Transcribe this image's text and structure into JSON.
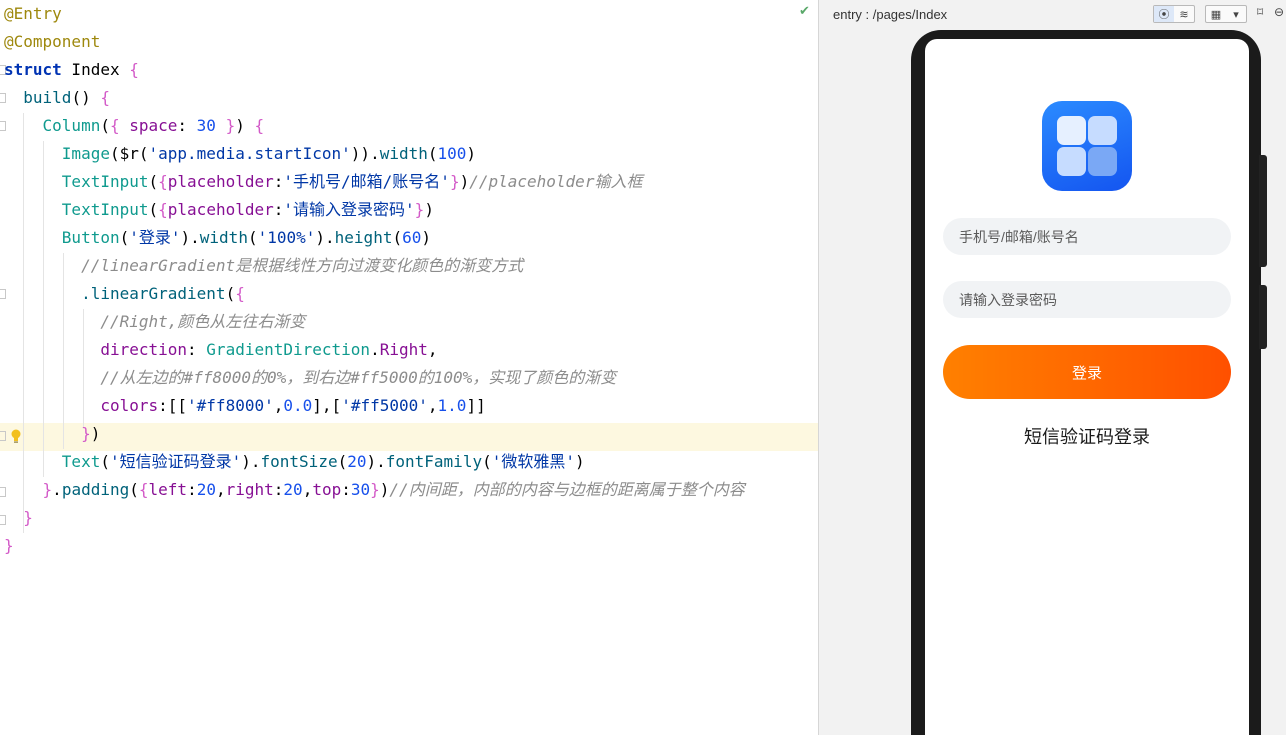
{
  "editor": {
    "lines": [
      {
        "parts": [
          {
            "c": "ann",
            "t": "@Entry"
          }
        ]
      },
      {
        "parts": [
          {
            "c": "ann",
            "t": "@Component"
          }
        ]
      },
      {
        "parts": [
          {
            "c": "kw",
            "t": "struct"
          },
          {
            "c": "cls",
            "t": " Index "
          },
          {
            "c": "br1",
            "t": "{"
          }
        ]
      },
      {
        "parts": [
          {
            "c": "fn",
            "t": "  build"
          },
          {
            "c": "cls",
            "t": "() "
          },
          {
            "c": "br1",
            "t": "{"
          }
        ]
      },
      {
        "parts": [
          {
            "c": "teal",
            "t": "    Column"
          },
          {
            "c": "cls",
            "t": "("
          },
          {
            "c": "br1",
            "t": "{ "
          },
          {
            "c": "prop",
            "t": "space"
          },
          {
            "c": "cls",
            "t": ": "
          },
          {
            "c": "num",
            "t": "30"
          },
          {
            "c": "br1",
            "t": " }"
          },
          {
            "c": "cls",
            "t": ") "
          },
          {
            "c": "br1",
            "t": "{"
          }
        ]
      },
      {
        "parts": [
          {
            "c": "teal",
            "t": "      Image"
          },
          {
            "c": "cls",
            "t": "($r("
          },
          {
            "c": "str2",
            "t": "'app.media.startIcon'"
          },
          {
            "c": "cls",
            "t": "))."
          },
          {
            "c": "meth",
            "t": "width"
          },
          {
            "c": "cls",
            "t": "("
          },
          {
            "c": "num",
            "t": "100"
          },
          {
            "c": "cls",
            "t": ")"
          }
        ]
      },
      {
        "parts": [
          {
            "c": "teal",
            "t": "      TextInput"
          },
          {
            "c": "cls",
            "t": "("
          },
          {
            "c": "br1",
            "t": "{"
          },
          {
            "c": "prop",
            "t": "placeholder"
          },
          {
            "c": "cls",
            "t": ":"
          },
          {
            "c": "str2",
            "t": "'手机号/邮箱/账号名'"
          },
          {
            "c": "br1",
            "t": "}"
          },
          {
            "c": "cls",
            "t": ")"
          },
          {
            "c": "cm",
            "t": "//placeholder输入框"
          }
        ]
      },
      {
        "parts": [
          {
            "c": "teal",
            "t": "      TextInput"
          },
          {
            "c": "cls",
            "t": "("
          },
          {
            "c": "br1",
            "t": "{"
          },
          {
            "c": "prop",
            "t": "placeholder"
          },
          {
            "c": "cls",
            "t": ":"
          },
          {
            "c": "str2",
            "t": "'请输入登录密码'"
          },
          {
            "c": "br1",
            "t": "}"
          },
          {
            "c": "cls",
            "t": ")"
          }
        ]
      },
      {
        "parts": [
          {
            "c": "teal",
            "t": "      Button"
          },
          {
            "c": "cls",
            "t": "("
          },
          {
            "c": "str2",
            "t": "'登录'"
          },
          {
            "c": "cls",
            "t": ")."
          },
          {
            "c": "meth",
            "t": "width"
          },
          {
            "c": "cls",
            "t": "("
          },
          {
            "c": "str2",
            "t": "'100%'"
          },
          {
            "c": "cls",
            "t": ")."
          },
          {
            "c": "meth",
            "t": "height"
          },
          {
            "c": "cls",
            "t": "("
          },
          {
            "c": "num",
            "t": "60"
          },
          {
            "c": "cls",
            "t": ")"
          }
        ]
      },
      {
        "parts": [
          {
            "c": "cm",
            "t": "        //linearGradient是根据线性方向过渡变化颜色的渐变方式"
          }
        ]
      },
      {
        "parts": [
          {
            "c": "meth",
            "t": "        .linearGradient"
          },
          {
            "c": "cls",
            "t": "("
          },
          {
            "c": "br1",
            "t": "{"
          }
        ]
      },
      {
        "parts": [
          {
            "c": "cm",
            "t": "          //Right,颜色从左往右渐变"
          }
        ]
      },
      {
        "parts": [
          {
            "c": "prop",
            "t": "          direction"
          },
          {
            "c": "cls",
            "t": ": "
          },
          {
            "c": "teal",
            "t": "GradientDirection"
          },
          {
            "c": "cls",
            "t": "."
          },
          {
            "c": "prop",
            "t": "Right"
          },
          {
            "c": "cls",
            "t": ","
          }
        ]
      },
      {
        "parts": [
          {
            "c": "cm",
            "t": "          //从左边的#ff8000的0%，到右边#ff5000的100%，实现了颜色的渐变"
          }
        ]
      },
      {
        "parts": [
          {
            "c": "prop",
            "t": "          colors"
          },
          {
            "c": "cls",
            "t": ":[["
          },
          {
            "c": "str2",
            "t": "'#ff8000'"
          },
          {
            "c": "cls",
            "t": ","
          },
          {
            "c": "num",
            "t": "0.0"
          },
          {
            "c": "cls",
            "t": "],["
          },
          {
            "c": "str2",
            "t": "'#ff5000'"
          },
          {
            "c": "cls",
            "t": ","
          },
          {
            "c": "num",
            "t": "1.0"
          },
          {
            "c": "cls",
            "t": "]]"
          }
        ]
      },
      {
        "parts": [
          {
            "c": "br1",
            "t": "        }"
          },
          {
            "c": "cls",
            "t": ")"
          }
        ]
      },
      {
        "parts": [
          {
            "c": "teal",
            "t": "      Text"
          },
          {
            "c": "cls",
            "t": "("
          },
          {
            "c": "str2",
            "t": "'短信验证码登录'"
          },
          {
            "c": "cls",
            "t": ")."
          },
          {
            "c": "meth",
            "t": "fontSize"
          },
          {
            "c": "cls",
            "t": "("
          },
          {
            "c": "num",
            "t": "20"
          },
          {
            "c": "cls",
            "t": ")."
          },
          {
            "c": "meth",
            "t": "fontFamily"
          },
          {
            "c": "cls",
            "t": "("
          },
          {
            "c": "str2",
            "t": "'微软雅黑'"
          },
          {
            "c": "cls",
            "t": ")"
          }
        ]
      },
      {
        "parts": [
          {
            "c": "br1",
            "t": "    }"
          },
          {
            "c": "cls",
            "t": "."
          },
          {
            "c": "meth",
            "t": "padding"
          },
          {
            "c": "cls",
            "t": "("
          },
          {
            "c": "br1",
            "t": "{"
          },
          {
            "c": "prop",
            "t": "left"
          },
          {
            "c": "cls",
            "t": ":"
          },
          {
            "c": "num",
            "t": "20"
          },
          {
            "c": "cls",
            "t": ","
          },
          {
            "c": "prop",
            "t": "right"
          },
          {
            "c": "cls",
            "t": ":"
          },
          {
            "c": "num",
            "t": "20"
          },
          {
            "c": "cls",
            "t": ","
          },
          {
            "c": "prop",
            "t": "top"
          },
          {
            "c": "cls",
            "t": ":"
          },
          {
            "c": "num",
            "t": "30"
          },
          {
            "c": "br1",
            "t": "}"
          },
          {
            "c": "cls",
            "t": ")"
          },
          {
            "c": "cm",
            "t": "//内间距，内部的内容与边框的距离属于整个内容"
          }
        ]
      },
      {
        "parts": [
          {
            "c": "br1",
            "t": "  }"
          }
        ]
      },
      {
        "parts": [
          {
            "c": "br1",
            "t": "}"
          }
        ]
      }
    ]
  },
  "previewer": {
    "path": "entry : /pages/Index",
    "toolbar": {
      "inspect_icon": "⦿",
      "layers_icon": "≋",
      "grid_icon": "▦",
      "dropdown_icon": "▾",
      "rotate_icon": "⌑",
      "zoom_icon": "⊖"
    },
    "app": {
      "account_placeholder": "手机号/邮箱/账号名",
      "password_placeholder": "请输入登录密码",
      "login_label": "登录",
      "sms_login_label": "短信验证码登录",
      "gradient_start": "#ff8000",
      "gradient_end": "#ff5000"
    }
  }
}
